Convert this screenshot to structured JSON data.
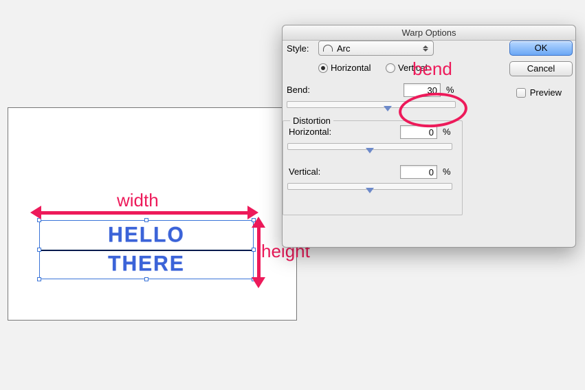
{
  "canvas": {
    "text_line1": "HELLO",
    "text_line2": "THERE"
  },
  "annotations": {
    "width": "width",
    "height": "height",
    "bend": "bend"
  },
  "dialog": {
    "title": "Warp Options",
    "style_label": "Style:",
    "style_value": "Arc",
    "orientation": {
      "horizontal": "Horizontal",
      "vertical": "Vertical",
      "selected": "horizontal"
    },
    "bend_label": "Bend:",
    "bend_value": "30",
    "pct": "%",
    "distortion": {
      "legend": "Distortion",
      "horizontal_label": "Horizontal:",
      "horizontal_value": "0",
      "vertical_label": "Vertical:",
      "vertical_value": "0"
    },
    "buttons": {
      "ok": "OK",
      "cancel": "Cancel"
    },
    "preview_label": "Preview"
  }
}
